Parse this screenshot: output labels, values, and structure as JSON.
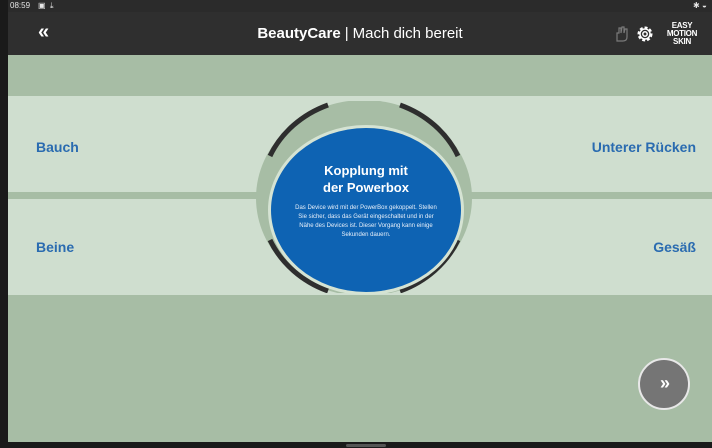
{
  "status_bar": {
    "time": "08:59"
  },
  "app_bar": {
    "back_label": "«",
    "brand": "BeautyCare",
    "separator": "|",
    "subtitle": "Mach dich bereit",
    "logo_lines": [
      "EASY",
      "MOTION",
      "SKIN"
    ]
  },
  "zones": {
    "top_left": "Bauch",
    "top_right": "Unterer Rücken",
    "bottom_left": "Beine",
    "bottom_right": "Gesäß"
  },
  "pairing": {
    "heading_line1": "Kopplung mit",
    "heading_line2": "der Powerbox",
    "body": "Das Device wird mit der PowerBox gekoppelt. Stellen Sie sicher, dass das Gerät eingeschaltet und in der Nähe des Devices ist. Dieser Vorgang kann einige Sekunden dauern."
  },
  "next_button_label": "»",
  "colors": {
    "app_bar": "#2f2f2f",
    "background": "#a7bda5",
    "band": "#cfdecf",
    "accent_blue": "#0e63b3",
    "zone_text": "#2a6bb0"
  },
  "icons": [
    "image-icon",
    "download-icon",
    "bluetooth-icon",
    "wifi-icon",
    "hand-icon",
    "gear-icon"
  ]
}
